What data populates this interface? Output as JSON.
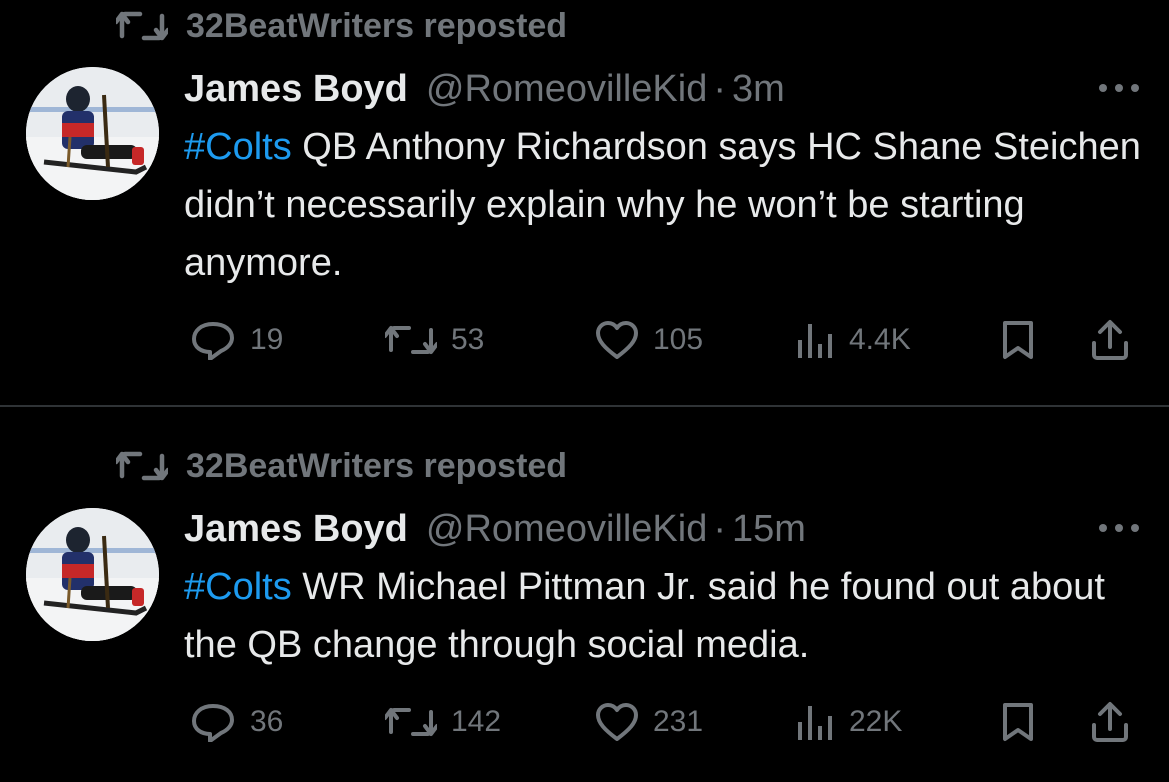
{
  "colors": {
    "background": "#000000",
    "text_primary": "#e7e9ea",
    "text_secondary": "#71767b",
    "hashtag": "#1d9bf0",
    "divider": "#2f3336"
  },
  "tweets": [
    {
      "repost_label": "32BeatWriters reposted",
      "display_name": "James Boyd",
      "handle": "@RomeovilleKid",
      "separator": "·",
      "time": "3m",
      "hashtag": "#Colts",
      "text": " QB Anthony Richardson says HC Shane Steichen didn’t necessarily explain why he won’t be starting anymore.",
      "avatar_icon": "sled-hockey-player-avatar",
      "more_icon": "more-icon",
      "stats": {
        "replies": "19",
        "reposts": "53",
        "likes": "105",
        "views": "4.4K"
      }
    },
    {
      "repost_label": "32BeatWriters reposted",
      "display_name": "James Boyd",
      "handle": "@RomeovilleKid",
      "separator": "·",
      "time": "15m",
      "hashtag": "#Colts",
      "text": " WR Michael Pittman Jr. said he found out about the QB change through social media.",
      "avatar_icon": "sled-hockey-player-avatar",
      "more_icon": "more-icon",
      "stats": {
        "replies": "36",
        "reposts": "142",
        "likes": "231",
        "views": "22K"
      }
    }
  ]
}
